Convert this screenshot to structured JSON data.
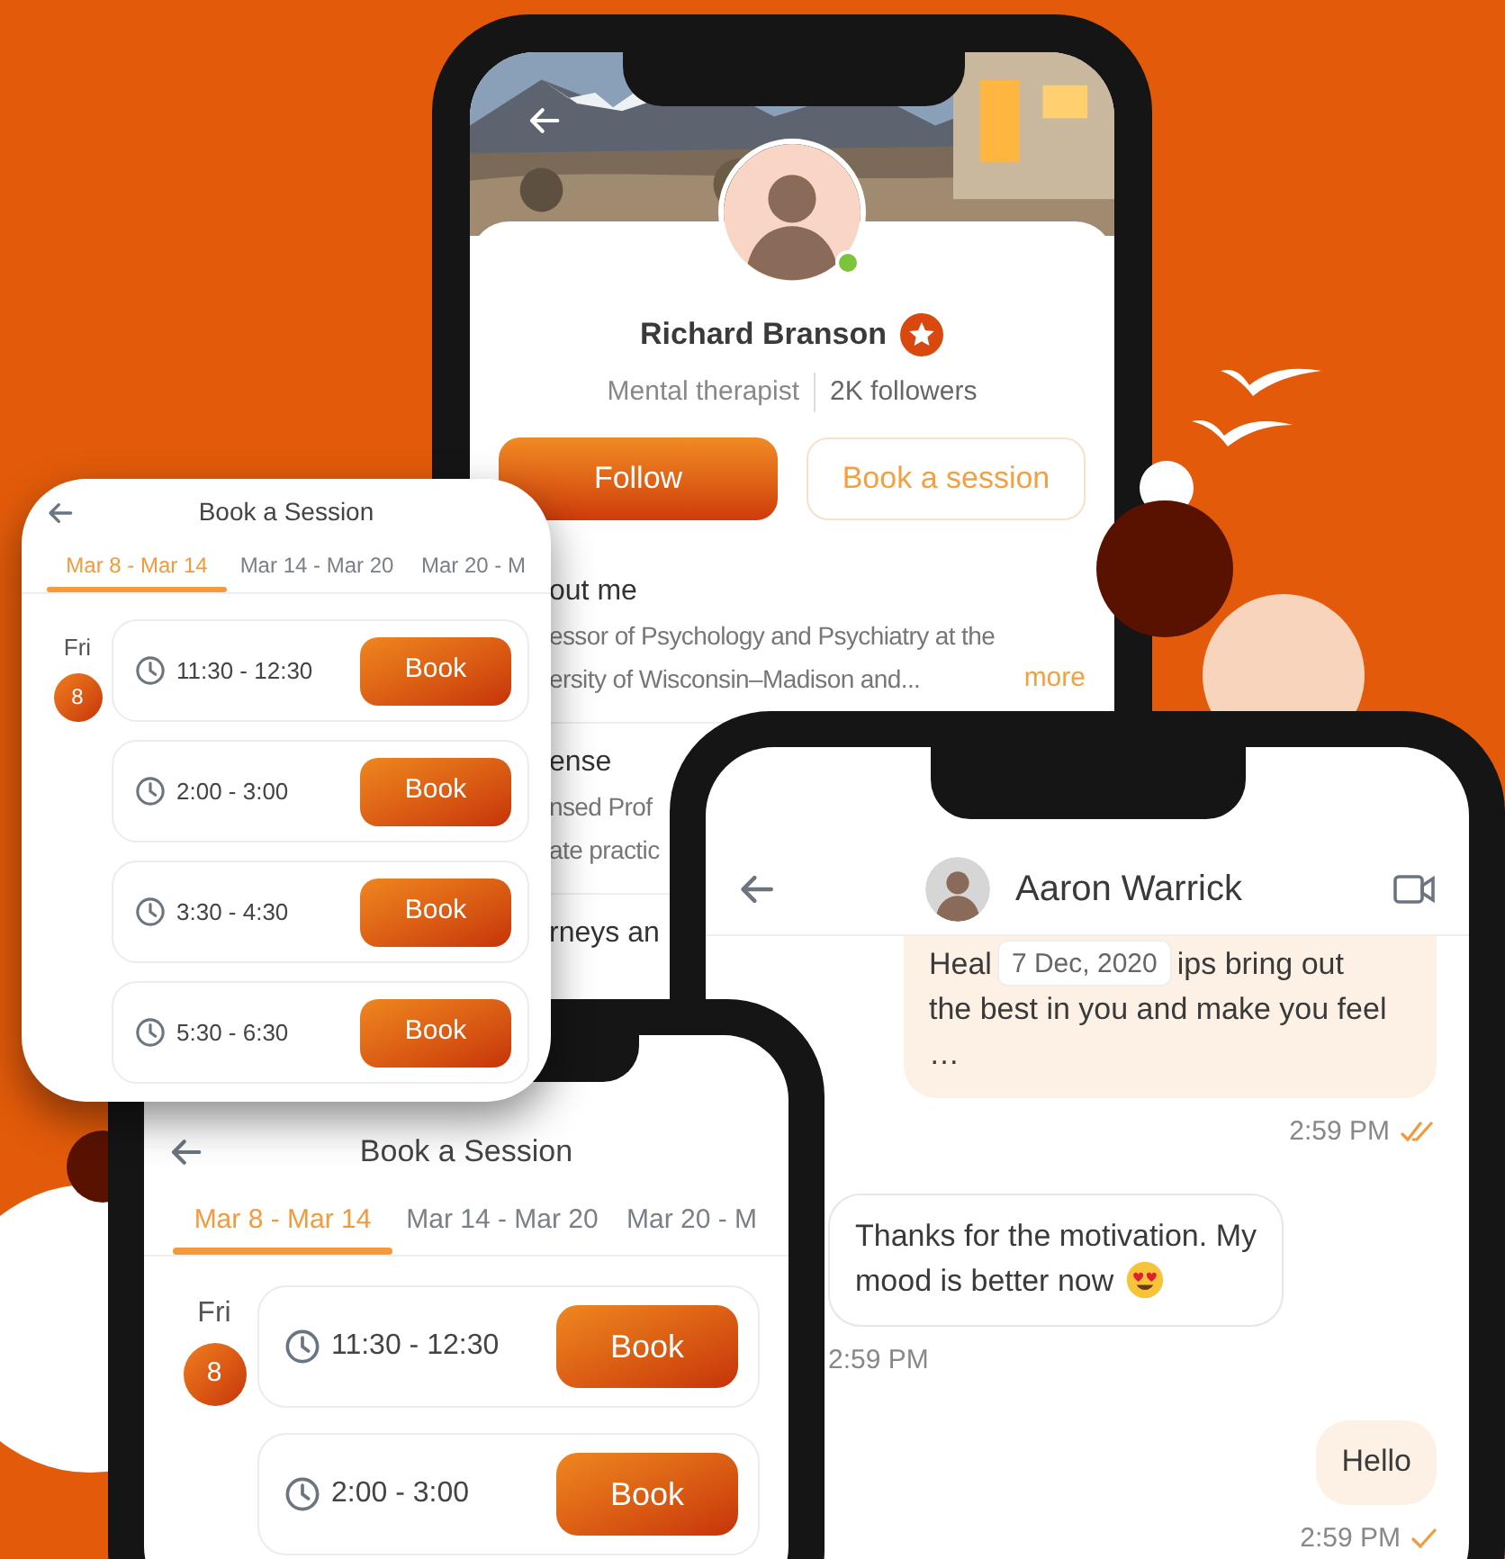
{
  "profile": {
    "name": "Richard Branson",
    "role": "Mental therapist",
    "followers": "2K followers",
    "online": true,
    "follow": "Follow",
    "book": "Book a session",
    "sections": [
      {
        "heading": "out me",
        "lines": [
          "essor of Psychology and Psychiatry at the",
          "ersity of Wisconsin–Madison and..."
        ],
        "more": "more"
      },
      {
        "heading": "ense",
        "lines": [
          "nsed Prof",
          "ate practic"
        ]
      },
      {
        "heading": "rneys an"
      }
    ]
  },
  "chat": {
    "contact": "Aaron Warrick",
    "date_chip": "7 Dec, 2020",
    "messages": [
      {
        "kind": "outgoing",
        "first_line": [
          "Heal",
          "ips bring out"
        ],
        "lines": [
          "the best in you and make you feel …"
        ],
        "time": "2:59 PM",
        "read": true
      },
      {
        "kind": "incoming",
        "lines": [
          "Thanks for the motivation. My",
          "mood is better now"
        ],
        "emoji": true,
        "time": "2:59 PM"
      },
      {
        "kind": "outgoing",
        "lines": [
          "Hello"
        ],
        "time": "2:59 PM",
        "read": false
      }
    ]
  },
  "booking_phone": {
    "title": "Book a Session",
    "tabs": [
      {
        "label": "Mar 8 - Mar 14",
        "selected": true
      },
      {
        "label": "Mar 14 - Mar 20",
        "selected": false
      },
      {
        "label": "Mar 20 - M",
        "selected": false
      }
    ],
    "day": "Fri",
    "date": "8",
    "slots": [
      {
        "time": "11:30 - 12:30",
        "action": "Book"
      },
      {
        "time": "2:00 - 3:00",
        "action": "Book"
      }
    ]
  },
  "booking_card": {
    "title": "Book a Session",
    "tabs": [
      {
        "label": "Mar 8 - Mar 14",
        "selected": true
      },
      {
        "label": "Mar 14 - Mar 20",
        "selected": false
      },
      {
        "label": "Mar 20 - M",
        "selected": false
      }
    ],
    "day": "Fri",
    "date": "8",
    "slots": [
      {
        "time": "11:30 - 12:30",
        "action": "Book"
      },
      {
        "time": "2:00 - 3:00",
        "action": "Book"
      },
      {
        "time": "3:30 - 4:30",
        "action": "Book"
      },
      {
        "time": "5:30 - 6:30",
        "action": "Book"
      }
    ]
  }
}
